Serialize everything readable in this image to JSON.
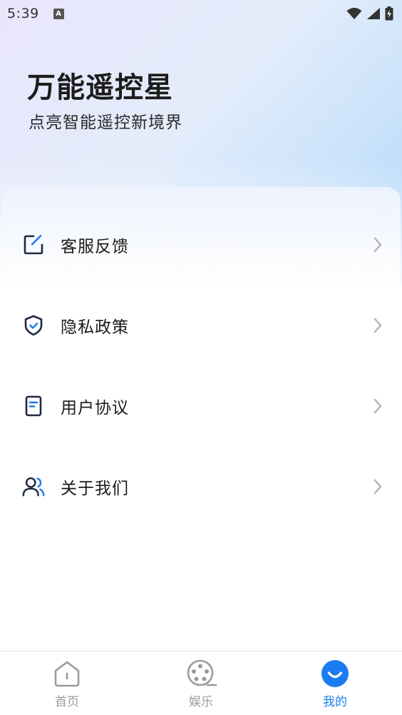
{
  "status_bar": {
    "time": "5:39",
    "notification_letter": "A",
    "icons": [
      "wifi-icon",
      "signal-icon",
      "battery-charging-icon"
    ]
  },
  "header": {
    "title": "万能遥控星",
    "subtitle": "点亮智能遥控新境界"
  },
  "menu": {
    "items": [
      {
        "label": "客服反馈",
        "icon": "feedback-edit-icon"
      },
      {
        "label": "隐私政策",
        "icon": "shield-check-icon"
      },
      {
        "label": "用户协议",
        "icon": "document-icon"
      },
      {
        "label": "关于我们",
        "icon": "users-icon"
      }
    ],
    "chevron_icon": "chevron-right-icon"
  },
  "tab_bar": {
    "tabs": [
      {
        "label": "首页",
        "icon": "home-icon",
        "active": false
      },
      {
        "label": "娱乐",
        "icon": "film-reel-icon",
        "active": false
      },
      {
        "label": "我的",
        "icon": "smile-face-icon",
        "active": true
      }
    ]
  },
  "colors": {
    "accent": "#1a7cf0",
    "icon_dark": "#1f2a44",
    "inactive": "#9a9a9a",
    "chevron": "#b8b8b8"
  }
}
